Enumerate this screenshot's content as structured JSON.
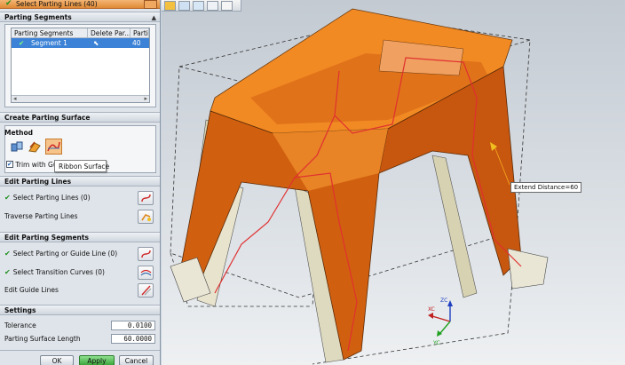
{
  "dialog": {
    "top_item": "Select Parting Lines (40)",
    "parting_segments": {
      "header": "Parting Segments",
      "columns": [
        "Parting Segments",
        "Delete Par...",
        "Partin"
      ],
      "rows": [
        {
          "segment": "Segment 1",
          "count": "40"
        }
      ]
    },
    "create_surface": {
      "header": "Create Parting Surface",
      "method_label": "Method",
      "trim_label": "Trim with Gu",
      "tooltip": "Ribbon Surface"
    },
    "edit_lines": {
      "header": "Edit Parting Lines",
      "select_label": "Select Parting Lines (0)",
      "traverse_label": "Traverse Parting Lines"
    },
    "edit_segments": {
      "header": "Edit Parting Segments",
      "select_guide": "Select Parting or Guide Line (0)",
      "select_transition": "Select Transition Curves (0)",
      "edit_guide": "Edit Guide Lines"
    },
    "settings": {
      "header": "Settings",
      "tolerance_label": "Tolerance",
      "tolerance_value": "0.0100",
      "length_label": "Parting Surface Length",
      "length_value": "60.0000"
    },
    "buttons": {
      "ok": "OK",
      "apply": "Apply",
      "cancel": "Cancel"
    }
  },
  "viewport": {
    "extend_label": "Extend Distance=60",
    "axes": {
      "z": "ZC",
      "x": "XC",
      "y": "YC"
    }
  },
  "colors": {
    "model_orange": "#e07a1a",
    "model_side": "#d9d4b8",
    "parting_line": "#e03030",
    "accent_blue": "#3c82d6"
  }
}
